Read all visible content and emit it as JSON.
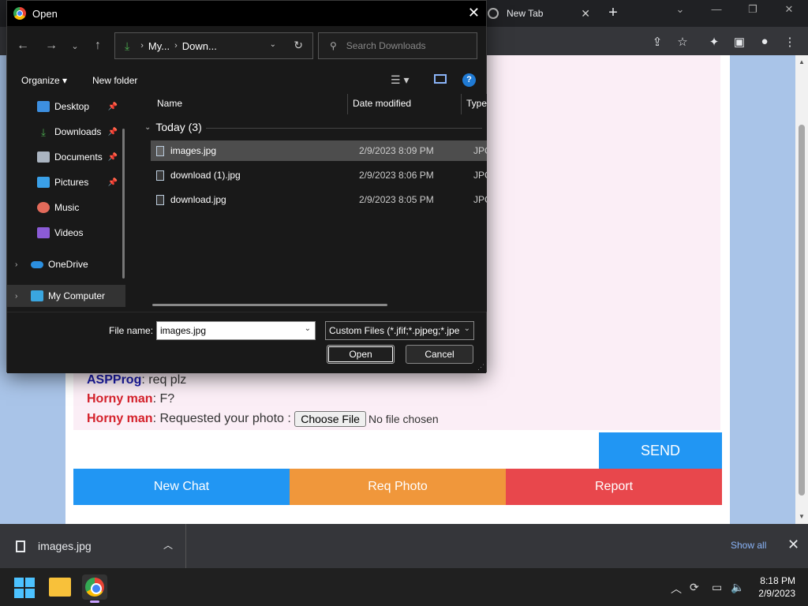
{
  "browser": {
    "tab_title": "New Tab"
  },
  "chat": {
    "messages": [
      {
        "sender": "ASPProg",
        "sender_type": "me",
        "text": ": req plz"
      },
      {
        "sender": "Horny man",
        "sender_type": "other",
        "text": ": F?"
      },
      {
        "sender": "Horny man",
        "sender_type": "other",
        "text": ": Requested your photo : "
      }
    ],
    "choose_file_label": "Choose File",
    "no_file_text": "No file chosen",
    "send_label": "SEND",
    "buttons": {
      "new_chat": "New Chat",
      "req_photo": "Req Photo",
      "report": "Report"
    },
    "colors": {
      "me": "#1a1aa8",
      "other": "#d4212b",
      "send": "#2196f3",
      "new_chat": "#2196f3",
      "req_photo": "#f0973b",
      "report": "#e8474c"
    }
  },
  "download_bar": {
    "file_name": "images.jpg",
    "show_all": "Show all"
  },
  "taskbar": {
    "time": "8:18 PM",
    "date": "2/9/2023"
  },
  "dialog": {
    "title": "Open",
    "address": {
      "crumb1": "My...",
      "crumb2": "Down..."
    },
    "search_placeholder": "Search Downloads",
    "organize": "Organize",
    "new_folder": "New folder",
    "help": "?",
    "nav_items": [
      {
        "label": "Desktop",
        "icon": "desktop-icon",
        "pinned": true
      },
      {
        "label": "Downloads",
        "icon": "download-icon",
        "pinned": true
      },
      {
        "label": "Documents",
        "icon": "documents-icon",
        "pinned": true
      },
      {
        "label": "Pictures",
        "icon": "pictures-icon",
        "pinned": true
      },
      {
        "label": "Music",
        "icon": "music-icon",
        "pinned": false
      },
      {
        "label": "Videos",
        "icon": "videos-icon",
        "pinned": false
      },
      {
        "label": "OneDrive",
        "icon": "onedrive-icon",
        "pinned": false
      },
      {
        "label": "My Computer",
        "icon": "computer-icon",
        "pinned": false
      }
    ],
    "columns": [
      "Name",
      "Date modified",
      "Type"
    ],
    "group_label": "Today (3)",
    "files": [
      {
        "name": "images.jpg",
        "date": "2/9/2023 8:09 PM",
        "type": "JPG F",
        "selected": true
      },
      {
        "name": "download (1).jpg",
        "date": "2/9/2023 8:06 PM",
        "type": "JPG F",
        "selected": false
      },
      {
        "name": "download.jpg",
        "date": "2/9/2023 8:05 PM",
        "type": "JPG F",
        "selected": false
      }
    ],
    "file_name_label": "File name:",
    "file_name_value": "images.jpg",
    "file_type_value": "Custom Files (*.jfif;*.pjpeg;*.jpe",
    "open_label": "Open",
    "cancel_label": "Cancel"
  }
}
